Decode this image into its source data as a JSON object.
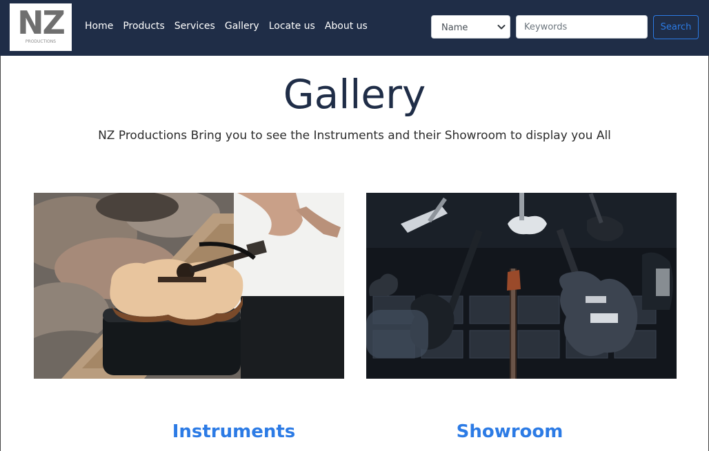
{
  "brand": {
    "logo_letters": "NZ",
    "logo_subtitle": "PRODUCTIONS"
  },
  "nav": {
    "links": [
      "Home",
      "Products",
      "Services",
      "Gallery",
      "Locate us",
      "About us"
    ]
  },
  "search": {
    "filter_selected": "Name",
    "keywords_placeholder": "Keywords",
    "button_label": "Search"
  },
  "main": {
    "title": "Gallery",
    "subtitle": "NZ Productions Bring you to see the Instruments and their Showroom to display you All",
    "cards": [
      {
        "title": "Instruments",
        "image": "acoustic-guitar-photo"
      },
      {
        "title": "Showroom",
        "image": "electric-guitars-photo"
      }
    ]
  },
  "colors": {
    "navbar": "#1f2d47",
    "accent": "#2c7be5",
    "title": "#1f2d47"
  }
}
